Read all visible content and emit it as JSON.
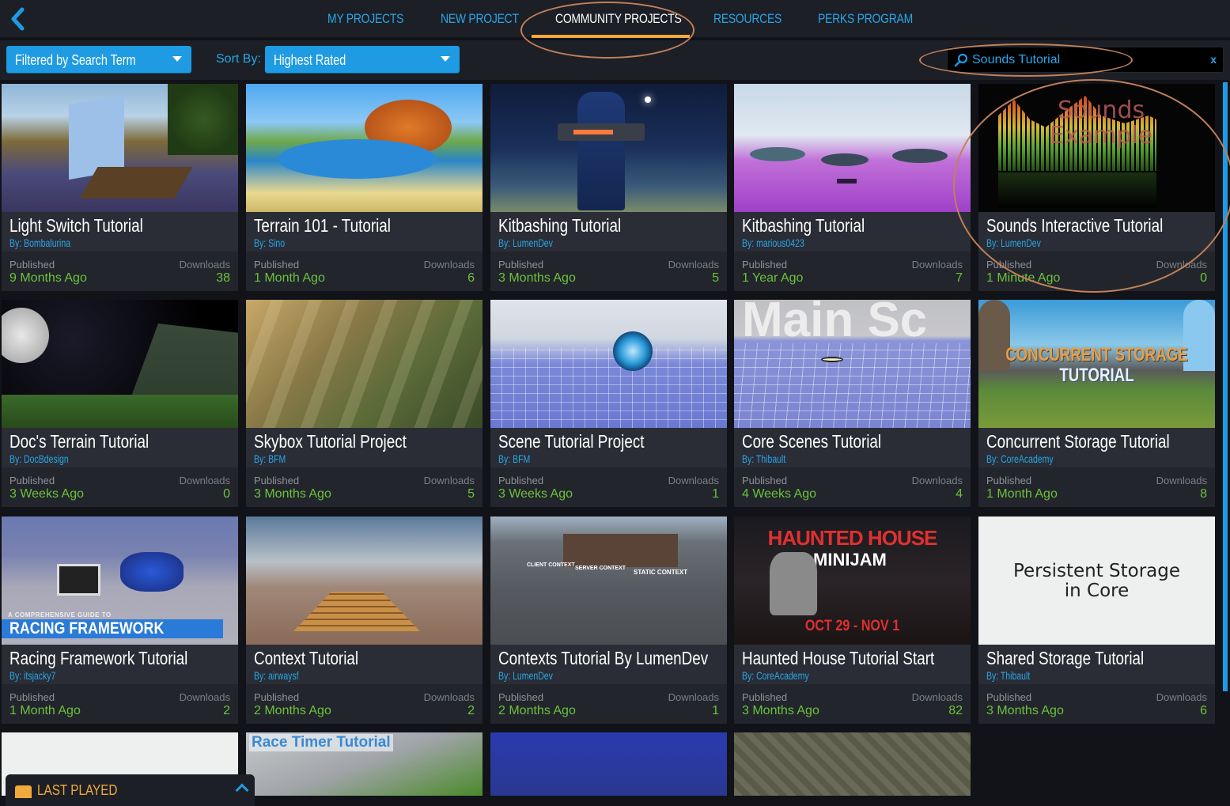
{
  "nav": {
    "back_label": "Back",
    "tabs": [
      {
        "label": "MY PROJECTS",
        "active": false
      },
      {
        "label": "NEW PROJECT",
        "active": false
      },
      {
        "label": "COMMUNITY PROJECTS",
        "active": true
      },
      {
        "label": "RESOURCES",
        "active": false
      },
      {
        "label": "PERKS PROGRAM",
        "active": false
      }
    ]
  },
  "filters": {
    "filter_value": "Filtered by Search Term",
    "sort_label": "Sort By:",
    "sort_value": "Highest Rated",
    "search_value": "Sounds Tutorial",
    "search_clear": "x"
  },
  "labels": {
    "published": "Published",
    "downloads": "Downloads"
  },
  "projects": [
    {
      "title": "Light Switch Tutorial",
      "author": "By: Bombalurina",
      "published": "9 Months Ago",
      "downloads": "38"
    },
    {
      "title": "Terrain 101 - Tutorial",
      "author": "By: Sino",
      "published": "1 Month Ago",
      "downloads": "6"
    },
    {
      "title": "Kitbashing Tutorial",
      "author": "By: LumenDev",
      "published": "3 Months Ago",
      "downloads": "5"
    },
    {
      "title": "Kitbashing Tutorial",
      "author": "By: marious0423",
      "published": "1 Year Ago",
      "downloads": "7"
    },
    {
      "title": "Sounds Interactive Tutorial",
      "author": "By: LumenDev",
      "published": "1 Minute Ago",
      "downloads": "0",
      "thumb_text": [
        "Sounds",
        "Example"
      ]
    },
    {
      "title": "Doc's Terrain Tutorial",
      "author": "By: DocBdesign",
      "published": "3 Weeks Ago",
      "downloads": "0"
    },
    {
      "title": "Skybox Tutorial Project",
      "author": "By: BFM",
      "published": "3 Months Ago",
      "downloads": "5"
    },
    {
      "title": "Scene Tutorial Project",
      "author": "By: BFM",
      "published": "3 Weeks Ago",
      "downloads": "1"
    },
    {
      "title": "Core Scenes Tutorial",
      "author": "By: Thibault",
      "published": "4 Weeks Ago",
      "downloads": "4",
      "thumb_text": [
        "Main Sc"
      ]
    },
    {
      "title": "Concurrent Storage Tutorial",
      "author": "By: CoreAcademy",
      "published": "1 Month Ago",
      "downloads": "8",
      "thumb_text": [
        "CONCURRENT STORAGE",
        "TUTORIAL"
      ]
    },
    {
      "title": "Racing Framework Tutorial",
      "author": "By: itsjacky7",
      "published": "1 Month Ago",
      "downloads": "2",
      "thumb_text": [
        "A COMPREHENSIVE GUIDE TO",
        "RACING FRAMEWORK"
      ]
    },
    {
      "title": "Context Tutorial",
      "author": "By: airwaysf",
      "published": "2 Months Ago",
      "downloads": "2"
    },
    {
      "title": "Contexts Tutorial By LumenDev",
      "author": "By: LumenDev",
      "published": "2 Months Ago",
      "downloads": "1",
      "thumb_text": [
        "CLIENT CONTEXT",
        "SERVER CONTEXT",
        "STATIC CONTEXT"
      ]
    },
    {
      "title": "Haunted House Tutorial Start",
      "author": "By: CoreAcademy",
      "published": "3 Months Ago",
      "downloads": "82",
      "thumb_text": [
        "HAUNTED HOUSE",
        "MINIJAM",
        "OCT 29 - NOV 1"
      ]
    },
    {
      "title": "Shared Storage Tutorial",
      "author": "By: Thibault",
      "published": "3 Months Ago",
      "downloads": "6",
      "thumb_text": [
        "Persistent Storage",
        "in Core"
      ]
    }
  ],
  "partial_row": [
    {
      "thumb_text": ""
    },
    {
      "thumb_text": "Race Timer Tutorial"
    },
    {
      "thumb_text": ""
    },
    {
      "thumb_text": ""
    }
  ],
  "last_played": {
    "label": "LAST PLAYED"
  },
  "colors": {
    "accent_blue": "#1e9be2",
    "active_tab_underline": "#f2a93b",
    "published_green": "#6cc23a",
    "annotation": "#c0805a"
  }
}
